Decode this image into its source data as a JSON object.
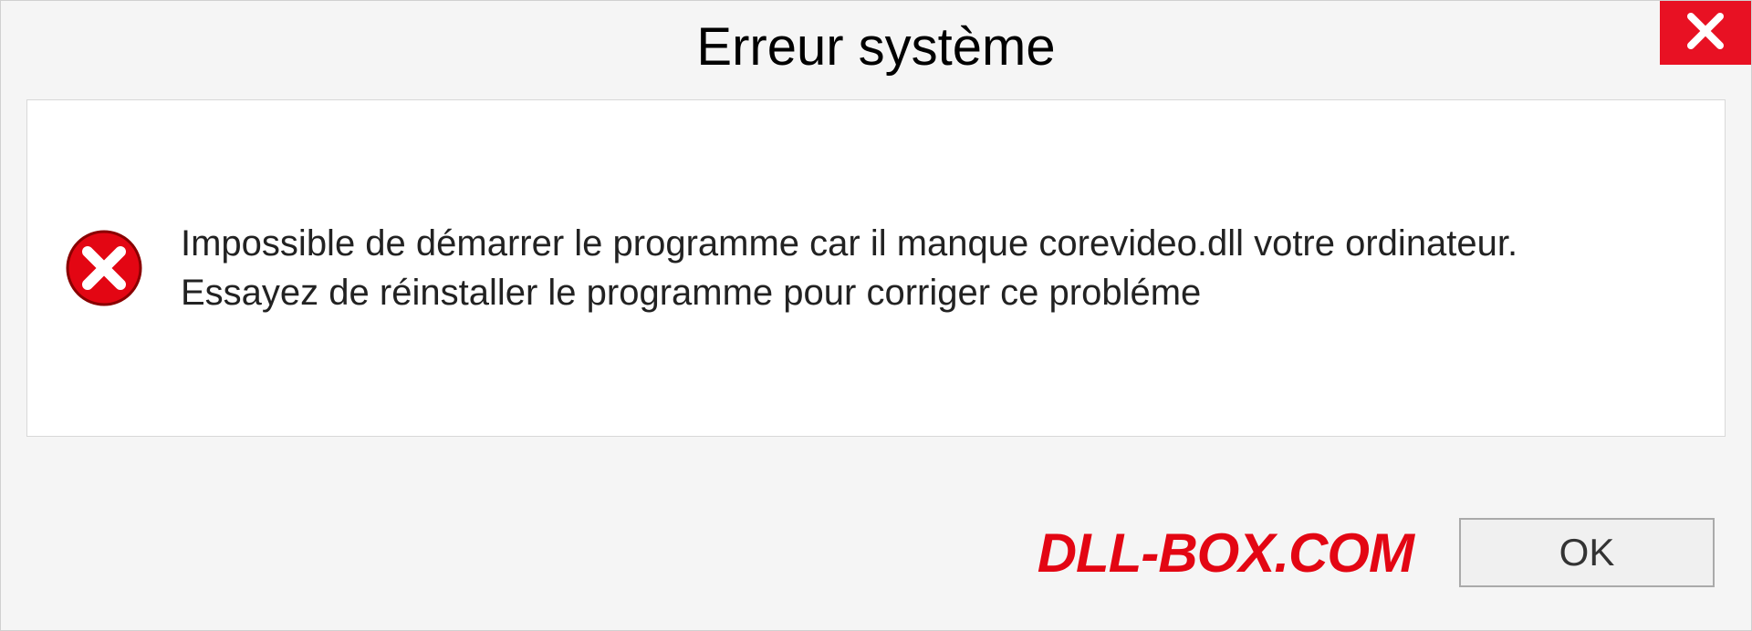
{
  "title": "Erreur système",
  "message": "Impossible de démarrer le programme car il manque corevideo.dll votre ordinateur. Essayez de réinstaller le programme pour corriger ce probléme",
  "brand": "DLL-BOX.COM",
  "ok_label": "OK",
  "colors": {
    "close_bg": "#e81123",
    "brand_fg": "#e30613"
  }
}
